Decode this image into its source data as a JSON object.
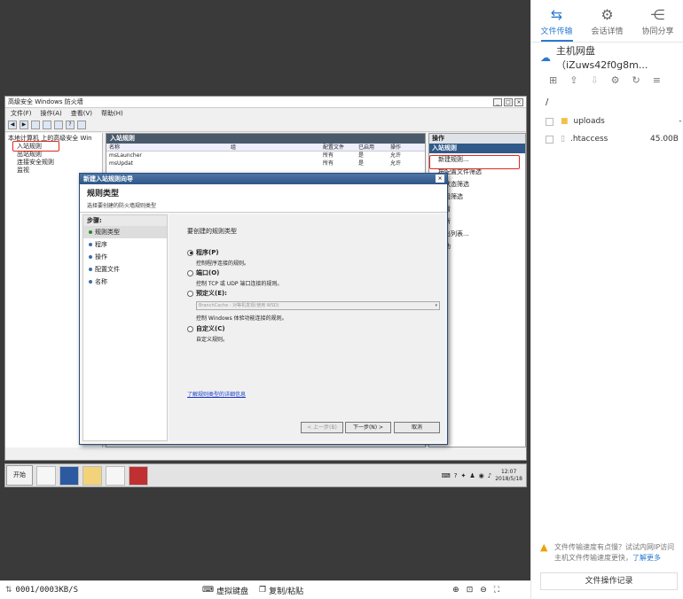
{
  "remote": {
    "window": {
      "title": "高级安全 Windows 防火墙"
    },
    "menu": [
      "文件(F)",
      "操作(A)",
      "查看(V)",
      "帮助(H)"
    ],
    "tree": [
      "本地计算机 上的高级安全 Win",
      "入站规则",
      "出站规则",
      "连接安全规则",
      "监视"
    ],
    "middle": {
      "header": "入站规则",
      "columns": [
        "名称",
        "组",
        "配置文件",
        "已启用",
        "操作"
      ],
      "rows": [
        [
          "msLauncher",
          "",
          "所有",
          "是",
          "允许"
        ],
        [
          "msUpdat",
          "",
          "所有",
          "是",
          "允许"
        ]
      ]
    },
    "actions": {
      "header": "操作",
      "selected": "入站规则",
      "items": [
        "新建规则...",
        "按配置文件筛选",
        "按状态筛选",
        "按组筛选",
        "查看",
        "刷新",
        "导出列表...",
        "帮助"
      ]
    },
    "dialog": {
      "title": "新建入站规则向导",
      "heading": "规则类型",
      "subheading": "选择要创建的防火墙规则类型",
      "steps_header": "步骤:",
      "steps": [
        "规则类型",
        "程序",
        "操作",
        "配置文件",
        "名称"
      ],
      "question": "要创建的规则类型",
      "options": [
        {
          "label": "程序(P)",
          "desc": "控制程序连接的规则。"
        },
        {
          "label": "端口(O)",
          "desc": "控制 TCP 或 UDP 端口连接的规则。"
        },
        {
          "label": "预定义(E):",
          "desc": "控制 Windows 体验功能连接的规则。"
        },
        {
          "label": "自定义(C)",
          "desc": "自定义规则。"
        }
      ],
      "predefined_placeholder": "BranchCache - 对等机发现(使用 WSD)",
      "link": "了解规则类型的详细信息",
      "btn_back": "< 上一步(B)",
      "btn_next": "下一步(N) >",
      "btn_cancel": "取消"
    },
    "taskbar": {
      "start": "开始",
      "time": "12:07",
      "date": "2018/5/18"
    }
  },
  "bottom": {
    "transfer": "0001/0003KB/S",
    "keyboard": "虚拟键盘",
    "paste": "复制/粘贴"
  },
  "sidebar": {
    "tabs": [
      {
        "label": "文件传输",
        "icon": "file-transfer-icon"
      },
      {
        "label": "会话详情",
        "icon": "gear-icon"
      },
      {
        "label": "协同分享",
        "icon": "share-icon"
      }
    ],
    "host": "主机网盘（iZuws42f0g8m...",
    "path": "/",
    "files": [
      {
        "name": "uploads",
        "size": "-"
      },
      {
        "name": ".htaccess",
        "size": "45.00B"
      }
    ],
    "note": "文件传输速度有点慢？试试内网IP访问主机文件传输速度更快，",
    "note_link": "了解更多",
    "log_button": "文件操作记录"
  }
}
